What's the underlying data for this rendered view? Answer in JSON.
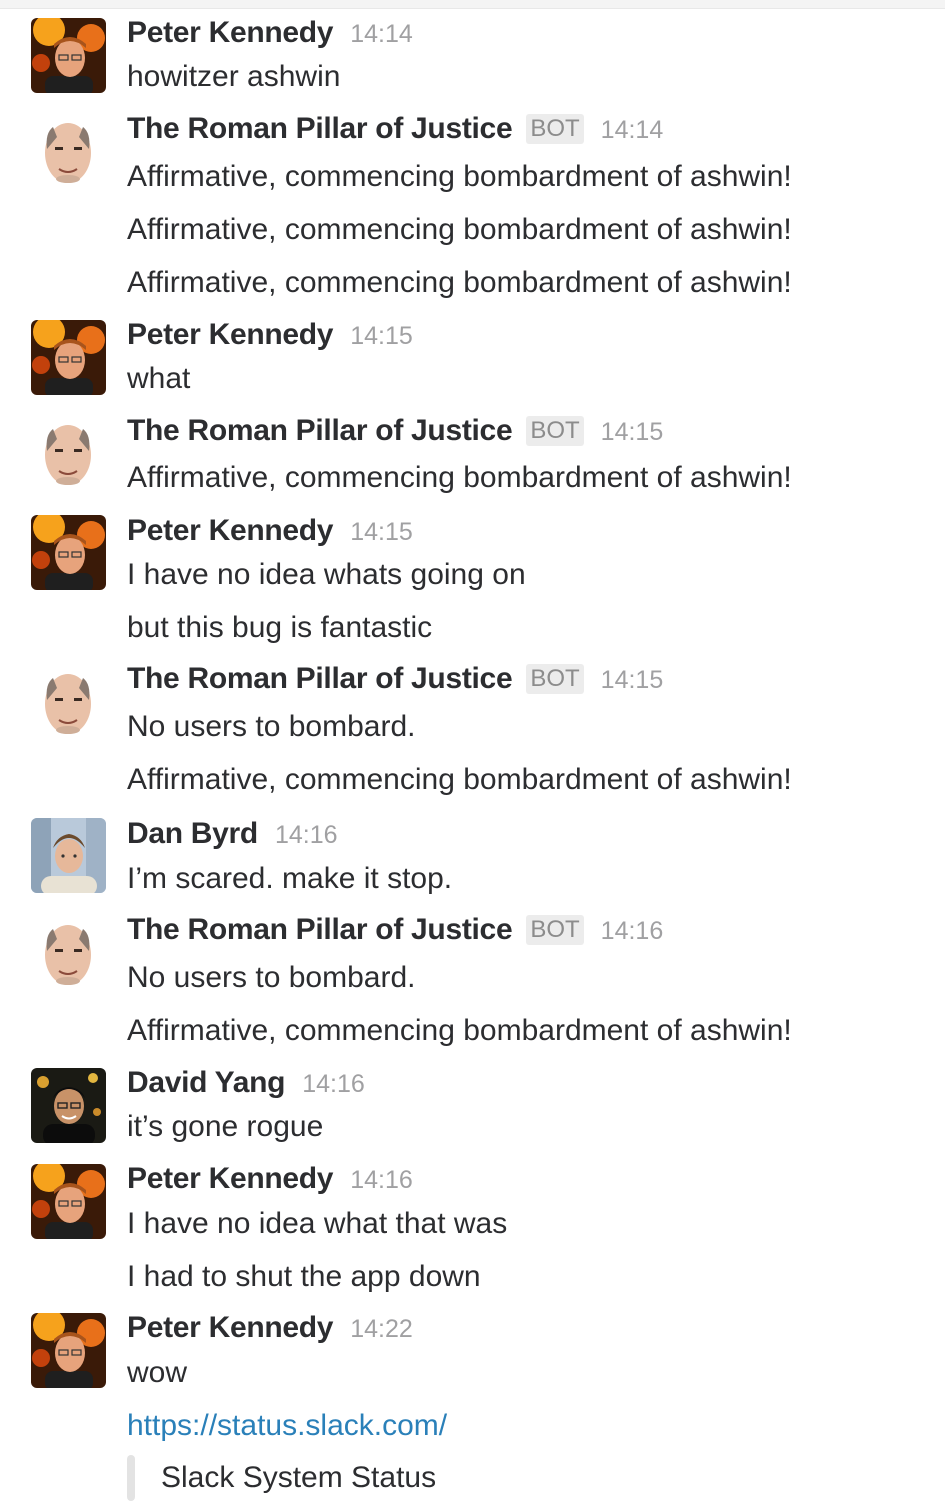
{
  "bot_badge": "BOT",
  "colors": {
    "link": "#2a80b9",
    "timestamp": "#a0a0a2",
    "text": "#2c2d30",
    "badge_bg": "#ececec"
  },
  "messages": [
    {
      "author": "Peter Kennedy",
      "avatar": "avatar-peter-kennedy",
      "time": "14:14",
      "bot": false,
      "lines": [
        "howitzer ashwin"
      ]
    },
    {
      "author": "The Roman Pillar of Justice",
      "avatar": "avatar-roman-pillar",
      "time": "14:14",
      "bot": true,
      "lines": [
        "Affirmative, commencing bombardment of ashwin!",
        "Affirmative, commencing bombardment of ashwin!",
        "Affirmative, commencing bombardment of ashwin!"
      ]
    },
    {
      "author": "Peter Kennedy",
      "avatar": "avatar-peter-kennedy",
      "time": "14:15",
      "bot": false,
      "lines": [
        "what"
      ]
    },
    {
      "author": "The Roman Pillar of Justice",
      "avatar": "avatar-roman-pillar",
      "time": "14:15",
      "bot": true,
      "lines": [
        "Affirmative, commencing bombardment of ashwin!"
      ]
    },
    {
      "author": "Peter Kennedy",
      "avatar": "avatar-peter-kennedy",
      "time": "14:15",
      "bot": false,
      "lines": [
        "I have no idea whats going on",
        "but this bug is fantastic"
      ]
    },
    {
      "author": "The Roman Pillar of Justice",
      "avatar": "avatar-roman-pillar",
      "time": "14:15",
      "bot": true,
      "lines": [
        "No users to bombard.",
        "Affirmative, commencing bombardment of ashwin!"
      ]
    },
    {
      "author": "Dan Byrd",
      "avatar": "avatar-dan-byrd",
      "time": "14:16",
      "bot": false,
      "lines": [
        "I’m scared. make it stop."
      ]
    },
    {
      "author": "The Roman Pillar of Justice",
      "avatar": "avatar-roman-pillar",
      "time": "14:16",
      "bot": true,
      "lines": [
        "No users to bombard.",
        "Affirmative, commencing bombardment of ashwin!"
      ]
    },
    {
      "author": "David Yang",
      "avatar": "avatar-david-yang",
      "time": "14:16",
      "bot": false,
      "lines": [
        "it’s gone rogue"
      ]
    },
    {
      "author": "Peter Kennedy",
      "avatar": "avatar-peter-kennedy",
      "time": "14:16",
      "bot": false,
      "lines": [
        "I have no idea what that was",
        "I had to shut the app down"
      ]
    },
    {
      "author": "Peter Kennedy",
      "avatar": "avatar-peter-kennedy",
      "time": "14:22",
      "bot": false,
      "lines": [
        "wow"
      ],
      "link": "https://status.slack.com/",
      "attachment_title": "Slack System Status"
    }
  ]
}
